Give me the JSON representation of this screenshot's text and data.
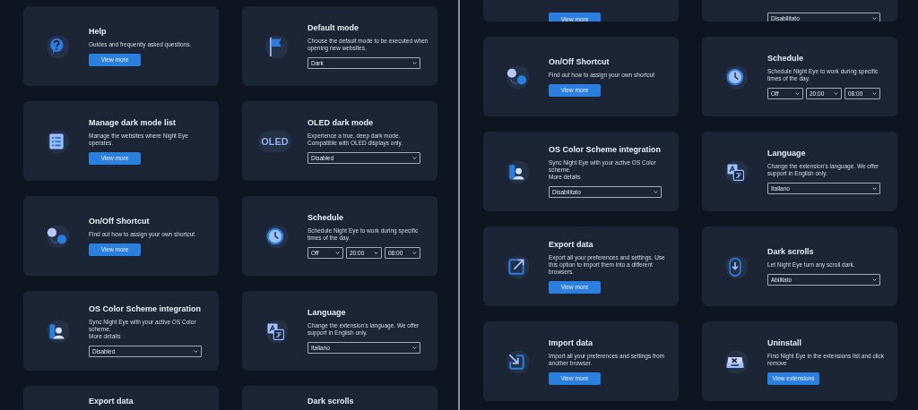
{
  "panels": [
    {
      "rows": [
        [
          {
            "title": "Help",
            "desc": "Guides and frequently asked questions.",
            "controls": [
              {
                "kind": "button",
                "label": "View more"
              }
            ]
          },
          {
            "title": "Default mode",
            "desc": "Choose the default mode to be executed when opening new websites.",
            "controls": [
              {
                "kind": "select",
                "value": "Dark"
              }
            ]
          }
        ],
        [
          {
            "title": "Manage dark mode list",
            "desc": "Manage the websites where Night Eye operates.",
            "controls": [
              {
                "kind": "button",
                "label": "View more"
              }
            ]
          },
          {
            "icon_label": "OLED",
            "title": "OLED dark mode",
            "desc": "Experience a true, deep dark mode. Compatible with OLED displays only.",
            "controls": [
              {
                "kind": "select",
                "value": "Disabled"
              }
            ]
          }
        ],
        [
          {
            "title": "On/Off Shortcut",
            "desc": "Find out how to assign your own shortcut",
            "controls": [
              {
                "kind": "button",
                "label": "View more"
              }
            ]
          },
          {
            "title": "Schedule",
            "desc": "Schedule Night Eye to work during specific times of the day.",
            "controls": [
              {
                "kind": "select",
                "value": "Off"
              },
              {
                "kind": "select",
                "value": "20:00"
              },
              {
                "kind": "select",
                "value": "08:00"
              }
            ]
          }
        ],
        [
          {
            "title": "OS Color Scheme integration",
            "desc": "Sync Night Eye with your active OS Color scheme.",
            "link": "More details",
            "controls": [
              {
                "kind": "select",
                "value": "Disabled"
              }
            ]
          },
          {
            "title": "Language",
            "desc": "Change the extension's language. We offer support in English only.",
            "controls": [
              {
                "kind": "select",
                "value": "Italiano"
              }
            ]
          }
        ],
        [
          {
            "title": "Export data"
          },
          {
            "title": "Dark scrolls"
          }
        ]
      ]
    },
    {
      "rows": [
        [
          {
            "controls": [
              {
                "kind": "button",
                "label": "View more"
              }
            ]
          },
          {
            "controls": [
              {
                "kind": "select",
                "value": "Disabilitato"
              }
            ]
          }
        ],
        [
          {
            "title": "On/Off Shortcut",
            "desc": "Find out how to assign your own shortcut",
            "controls": [
              {
                "kind": "button",
                "label": "View more"
              }
            ]
          },
          {
            "title": "Schedule",
            "desc": "Schedule Night Eye to work during specific times of the day.",
            "controls": [
              {
                "kind": "select",
                "value": "Off"
              },
              {
                "kind": "select",
                "value": "20:00"
              },
              {
                "kind": "select",
                "value": "08:00"
              }
            ]
          }
        ],
        [
          {
            "title": "OS Color Scheme integration",
            "desc": "Sync Night Eye with your active OS Color scheme.",
            "link": "More details",
            "controls": [
              {
                "kind": "select",
                "value": "Disabilitato"
              }
            ]
          },
          {
            "title": "Language",
            "desc": "Change the extension's language. We offer support in English only.",
            "controls": [
              {
                "kind": "select",
                "value": "Italiano"
              }
            ]
          }
        ],
        [
          {
            "title": "Export data",
            "desc": "Export all your preferences and settings. Use this option to import them into a different browsers.",
            "controls": [
              {
                "kind": "button",
                "label": "View more"
              }
            ]
          },
          {
            "title": "Dark scrolls",
            "desc": "Let Night Eye turn any scroll dark.",
            "controls": [
              {
                "kind": "select",
                "value": "Abilitato"
              }
            ]
          }
        ],
        [
          {
            "title": "Import data",
            "desc": "Import all your preferences and settings from another browser.",
            "controls": [
              {
                "kind": "button",
                "label": "View more"
              }
            ]
          },
          {
            "title": "Uninstall",
            "desc": "Find Night Eye in the extensions list and click remove",
            "controls": [
              {
                "kind": "button",
                "label": "View extensions"
              }
            ]
          }
        ]
      ]
    }
  ]
}
